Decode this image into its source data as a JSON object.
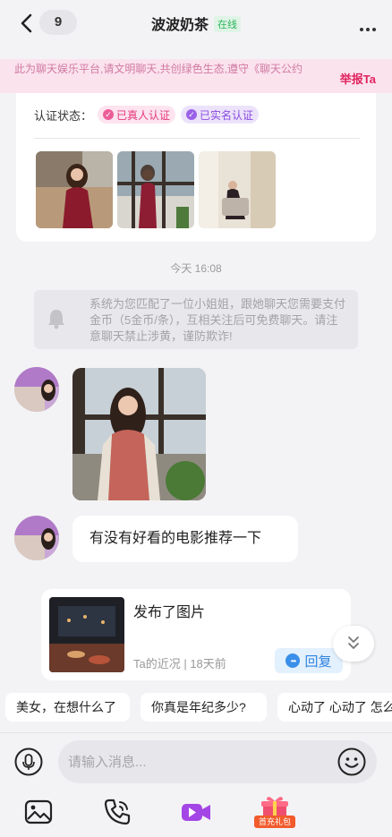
{
  "header": {
    "unread_count": "9",
    "title": "波波奶茶",
    "status": "在线"
  },
  "notice": {
    "text": "此为聊天娱乐平台,请文明聊天,共创绿色生态,遵守《聊天公约",
    "report_label": "举报Ta"
  },
  "profile_card": {
    "verify_label": "认证状态：",
    "badges": [
      "已真人认证",
      "已实名认证"
    ]
  },
  "chat": {
    "timestamp": "今天 16:08",
    "system_message": "系统为您匹配了一位小姐姐，跟她聊天您需要支付金币（5金币/条），互相关注后可免费聊天。请注意聊天禁止涉黄，谨防欺诈!",
    "text_message": "有没有好看的电影推荐一下"
  },
  "post": {
    "text": "发布了图片",
    "meta": "Ta的近况 | 18天前",
    "reply_label": "回复"
  },
  "quick_replies": [
    "美女，在想什么了",
    "你真是年纪多少?",
    "心动了 心动了 怎么"
  ],
  "input": {
    "placeholder": "请输入消息..."
  },
  "toolbar": {
    "gift_label": "首充礼包"
  },
  "colors": {
    "accent_pink": "#e0245e",
    "online_green": "#2bb35a",
    "video_purple": "#a445e6",
    "reply_blue": "#2f84e0"
  }
}
